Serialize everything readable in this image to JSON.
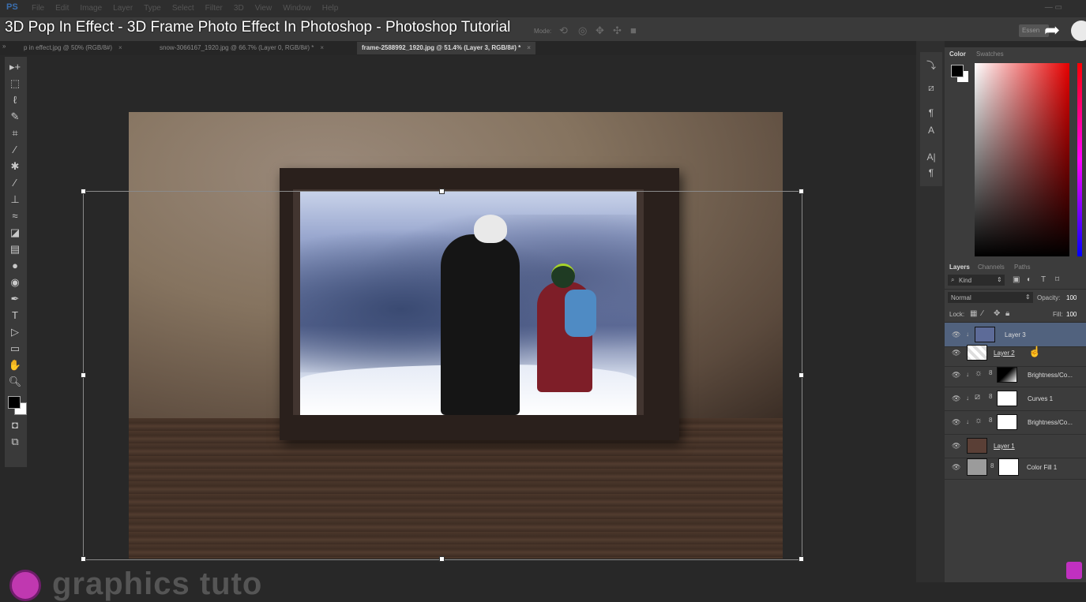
{
  "app": {
    "logo": "PS",
    "menu": [
      "File",
      "Edit",
      "Image",
      "Layer",
      "Type",
      "Select",
      "Filter",
      "3D",
      "View",
      "Window",
      "Help"
    ],
    "video_title": "3D Pop In Effect - 3D Frame Photo Effect In Photoshop - Photoshop Tutorial",
    "mode_label": "Mode:",
    "workspace": "Essen"
  },
  "tabs": [
    {
      "label": "p in effect.jpg @ 50% (RGB/8#)",
      "active": false
    },
    {
      "label": "snow-3066167_1920.jpg @ 66.7% (Layer 0, RGB/8#) *",
      "active": false
    },
    {
      "label": "frame-2588992_1920.jpg @ 51.4% (Layer 3, RGB/8#) *",
      "active": true
    }
  ],
  "tools": [
    "move-tool",
    "marquee-tool",
    "lasso-tool",
    "quick-select-tool",
    "crop-tool",
    "eyedropper-tool",
    "healing-brush-tool",
    "brush-tool",
    "clone-stamp-tool",
    "history-brush-tool",
    "eraser-tool",
    "gradient-tool",
    "blur-tool",
    "dodge-tool",
    "pen-tool",
    "type-tool",
    "path-select-tool",
    "rectangle-tool",
    "hand-tool",
    "zoom-tool"
  ],
  "color_panel": {
    "tabs": [
      "Color",
      "Swatches"
    ],
    "accent": "#e60000"
  },
  "layers_panel": {
    "tabs": [
      "Layers",
      "Channels",
      "Paths"
    ],
    "filter_kind": "Kind",
    "blend_mode": "Normal",
    "opacity_label": "Opacity:",
    "opacity_value": "100",
    "lock_label": "Lock:",
    "fill_label": "Fill:",
    "fill_value": "100",
    "layers": [
      {
        "name": "Layer 3",
        "selected": true
      },
      {
        "name": "Layer 2",
        "selected": false
      },
      {
        "name": "Brightness/Co...",
        "selected": false
      },
      {
        "name": "Curves 1",
        "selected": false
      },
      {
        "name": "Brightness/Co...",
        "selected": false
      },
      {
        "name": "Layer 1",
        "selected": false
      },
      {
        "name": "Color Fill 1",
        "selected": false
      }
    ]
  },
  "watermark": "graphics tuto"
}
